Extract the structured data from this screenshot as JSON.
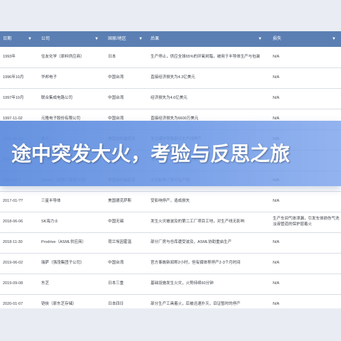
{
  "table": {
    "headers": [
      "日期",
      "公司",
      "国家/地区",
      "后果",
      "损失"
    ],
    "rows": [
      [
        "1993年",
        "住友化学（原料供应商）",
        "日本",
        "生产停止，供应全球65%的环氧树脂，被用于半导体生产与包装",
        "N/A"
      ],
      [
        "1996年10月",
        "华邦电子",
        "中国台湾",
        "直接经济损失为4.3亿美元",
        "N/A"
      ],
      [
        "1997年10月",
        "联合集成电路公司",
        "中国台湾",
        "经济损失为4.6亿美元",
        "N/A"
      ],
      [
        "1997-11-02",
        "元隆电子股份有限公司",
        "中国台湾",
        "直接经济损失为6600万美元",
        "N/A"
      ],
      [
        "2001-06-21",
        "美光",
        "美国加利福尼亚",
        "发生爆炸导致部分生产线停产",
        "N/A"
      ],
      [
        "2013-09-04",
        "SK海力士",
        "中国无锡",
        "发生火灾，部分生产线受影响",
        "N/A"
      ],
      [
        "2016-12-?",
        "Diodes（前称二极管公司）",
        "美国加利福尼亚",
        "火灾影响了部分生产线",
        "N/A"
      ],
      [
        "2017-01-??",
        "三星半导体",
        "美国德克萨斯",
        "受影响停产，造成损失",
        "N/A"
      ],
      [
        "2018-06-06",
        "SK海力士",
        "中国无锡",
        "发生火灾被波及的第二工厂项目工地，对生产线无影响",
        "生产车间气体泄漏，引发车体损伤气洗淡液管道的保护层着火"
      ],
      [
        "2018-11-30",
        "Prodrive（ASML供应商）",
        "荷兰埃因霍温",
        "部分厂房与仓库遭受波及，ASML协助重启生产",
        "N/A"
      ],
      [
        "2019-06-02",
        "瑞萨（强茂集团子公司）",
        "中国台湾",
        "官方事故新闻称2小时，但有媒体称停产2-3个月时间",
        "N/A"
      ],
      [
        "2019-09-08",
        "东芝",
        "日本三重",
        "基础设施发生火灾，火势持续60分钟",
        "N/A"
      ],
      [
        "2020-01-07",
        "铠侠（原东芝存储）",
        "日本四日",
        "部分生产工具着火，后被迅速扑灭，目证暂时的停产",
        "N/A"
      ]
    ]
  },
  "banner": {
    "title": "途中突发大火，考验与反思之旅"
  }
}
